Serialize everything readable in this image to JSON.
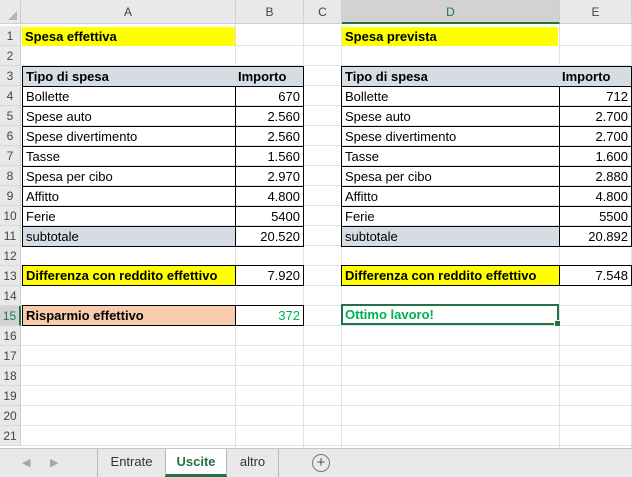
{
  "columns": [
    "A",
    "B",
    "C",
    "D",
    "E"
  ],
  "rows": [
    "1",
    "2",
    "3",
    "4",
    "5",
    "6",
    "7",
    "8",
    "9",
    "10",
    "11",
    "12",
    "13",
    "14",
    "15",
    "16",
    "17",
    "18",
    "19",
    "20",
    "21"
  ],
  "left": {
    "title": "Spesa effettiva",
    "header_type": "Tipo di spesa",
    "header_amount": "Importo",
    "items": [
      {
        "name": "Bollette",
        "amount": "670"
      },
      {
        "name": "Spese auto",
        "amount": "2.560"
      },
      {
        "name": "Spese divertimento",
        "amount": "2.560"
      },
      {
        "name": "Tasse",
        "amount": "1.560"
      },
      {
        "name": "Spesa per cibo",
        "amount": "2.970"
      },
      {
        "name": "Affitto",
        "amount": "4.800"
      },
      {
        "name": "Ferie",
        "amount": "5400"
      }
    ],
    "subtotal_label": "subtotale",
    "subtotal_value": "20.520",
    "diff_label": "Differenza con reddito effettivo",
    "diff_value": "7.920",
    "savings_label": "Risparmio effettivo",
    "savings_value": "372"
  },
  "right": {
    "title": "Spesa prevista",
    "header_type": "Tipo di spesa",
    "header_amount": "Importo",
    "items": [
      {
        "name": "Bollette",
        "amount": "712"
      },
      {
        "name": "Spese auto",
        "amount": "2.700"
      },
      {
        "name": "Spese divertimento",
        "amount": "2.700"
      },
      {
        "name": "Tasse",
        "amount": "1.600"
      },
      {
        "name": "Spesa per cibo",
        "amount": "2.880"
      },
      {
        "name": "Affitto",
        "amount": "4.800"
      },
      {
        "name": "Ferie",
        "amount": "5500"
      }
    ],
    "subtotal_label": "subtotale",
    "subtotal_value": "20.892",
    "diff_label": "Differenza con reddito effettivo",
    "diff_value": "7.548",
    "message": "Ottimo lavoro!"
  },
  "tabs": {
    "entrate": "Entrate",
    "uscite": "Uscite",
    "altro": "altro",
    "add": "+"
  },
  "colors": {
    "yellow": "#ffff00",
    "grey": "#d6dce4",
    "peach": "#f8cbad",
    "green_text": "#00b050",
    "excel_green": "#217346"
  }
}
